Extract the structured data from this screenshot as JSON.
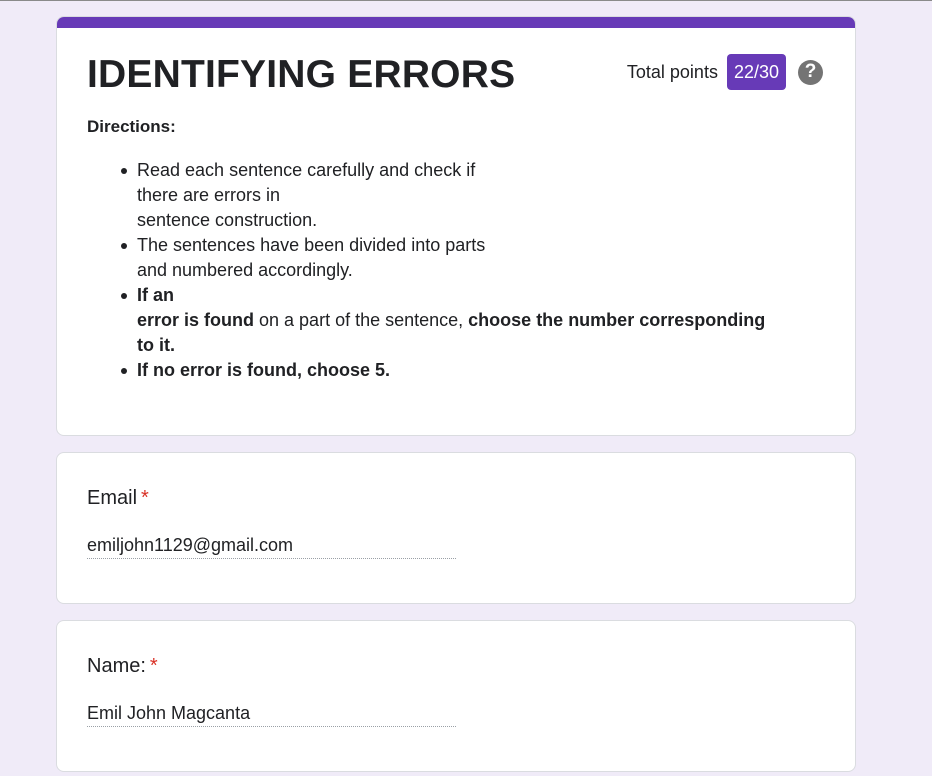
{
  "colors": {
    "accent": "#673ab7",
    "badge": "#673ab7",
    "background": "#f0ebf8",
    "required": "#d93025"
  },
  "header": {
    "title": "IDENTIFYING ERRORS",
    "points_label": "Total points",
    "points_value": "22/30",
    "help_icon": "help-circle-icon",
    "help_glyph": "?"
  },
  "directions": {
    "heading": "Directions:",
    "item1": {
      "line1": "Read each sentence carefully and check if",
      "line2": "there are errors in",
      "line3": "sentence construction."
    },
    "item2": {
      "line1": "The sentences have been divided into parts",
      "line2": "and numbered accordingly."
    },
    "item3": {
      "part1": "If an",
      "part2": "error is found",
      "part3": " on a part of the sentence, ",
      "part4": "choose the number corresponding to it."
    },
    "item4": "If no error is found, choose 5."
  },
  "questions": [
    {
      "label": "Email",
      "required_mark": "*",
      "value": "emiljohn1129@gmail.com"
    },
    {
      "label": "Name:",
      "required_mark": "*",
      "value": "Emil John Magcanta"
    }
  ]
}
